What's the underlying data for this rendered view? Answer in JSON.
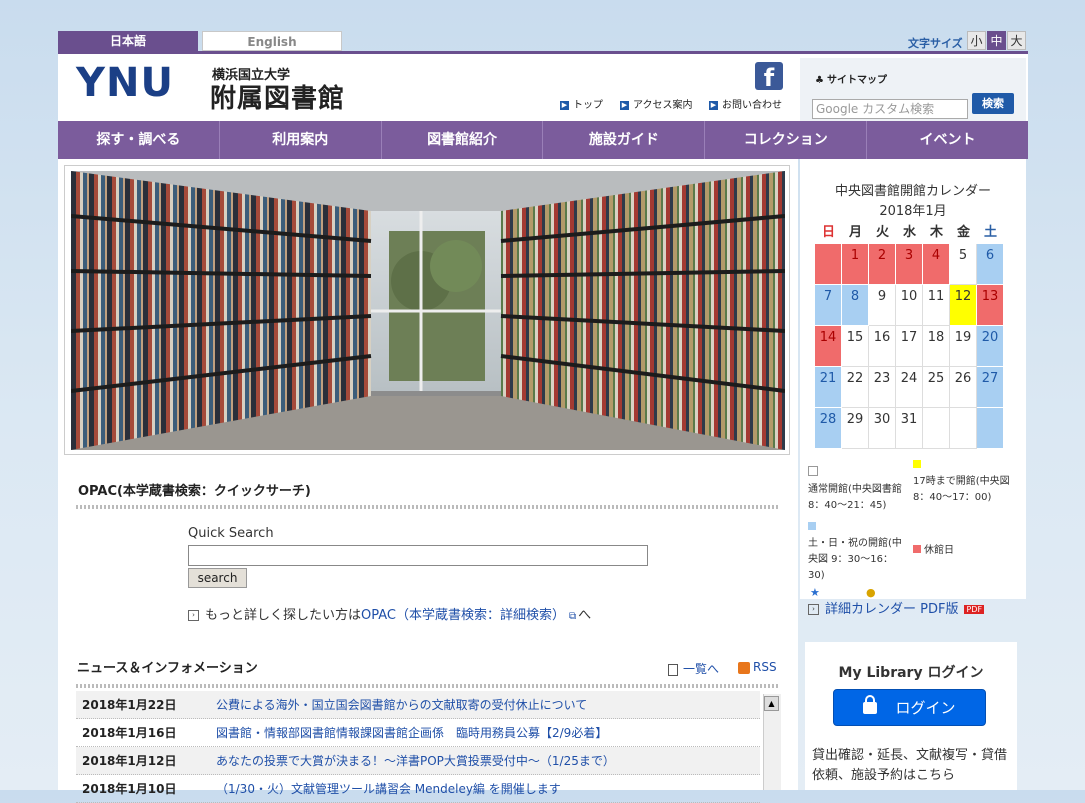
{
  "lang_tabs": {
    "japanese": "日本語",
    "english": "English"
  },
  "font_size": {
    "label": "文字サイズ",
    "small": "小",
    "medium": "中",
    "large": "大"
  },
  "header": {
    "logo_ynu": "YNU",
    "logo_univ": "横浜国立大学",
    "logo_lib": "附属図書館",
    "links": {
      "top": "トップ",
      "access": "アクセス案内",
      "contact": "お問い合わせ"
    },
    "sitemap": "サイトマップ",
    "search_placeholder": "Google カスタム検索",
    "search_button": "検索"
  },
  "nav": [
    "探す・調べる",
    "利用案内",
    "図書館紹介",
    "施設ガイド",
    "コレクション",
    "イベント"
  ],
  "opac": {
    "title": "OPAC(本学蔵書検索：クイックサーチ)",
    "quick_label": "Quick Search",
    "search_button": "search",
    "more_prefix": "もっと詳しく探したい方は",
    "more_link": "OPAC（本学蔵書検索：詳細検索）",
    "more_suffix": "へ"
  },
  "news": {
    "title": "ニュース＆インフォメーション",
    "list_link": "一覧へ",
    "rss": "RSS",
    "items": [
      {
        "date": "2018年1月22日",
        "text": "公費による海外・国立国会図書館からの文献取寄の受付休止について"
      },
      {
        "date": "2018年1月16日",
        "text": "図書館・情報部図書館情報課図書館企画係　臨時用務員公募【2/9必着】"
      },
      {
        "date": "2018年1月12日",
        "text": "あなたの投票で大賞が決まる！～洋書POP大賞投票受付中～（1/25まで）"
      },
      {
        "date": "2018年1月10日",
        "text": "（1/30・火）文献管理ツール講習会 Mendeley編 を開催します"
      }
    ]
  },
  "calendar": {
    "title": "中央図書館開館カレンダー",
    "month": "2018年1月",
    "weekdays": [
      "日",
      "月",
      "火",
      "水",
      "木",
      "金",
      "土"
    ],
    "days": [
      {
        "d": "",
        "t": "closed"
      },
      {
        "d": "1",
        "t": "closed"
      },
      {
        "d": "2",
        "t": "closed"
      },
      {
        "d": "3",
        "t": "closed"
      },
      {
        "d": "4",
        "t": "closed"
      },
      {
        "d": "5",
        "t": "normal"
      },
      {
        "d": "6",
        "t": "weekend"
      },
      {
        "d": "7",
        "t": "weekend"
      },
      {
        "d": "8",
        "t": "weekend"
      },
      {
        "d": "9",
        "t": "normal"
      },
      {
        "d": "10",
        "t": "normal"
      },
      {
        "d": "11",
        "t": "normal"
      },
      {
        "d": "12",
        "t": "short"
      },
      {
        "d": "13",
        "t": "closed"
      },
      {
        "d": "14",
        "t": "closed"
      },
      {
        "d": "15",
        "t": "normal"
      },
      {
        "d": "16",
        "t": "normal"
      },
      {
        "d": "17",
        "t": "normal"
      },
      {
        "d": "18",
        "t": "normal"
      },
      {
        "d": "19",
        "t": "normal"
      },
      {
        "d": "20",
        "t": "weekend"
      },
      {
        "d": "21",
        "t": "weekend"
      },
      {
        "d": "22",
        "t": "normal"
      },
      {
        "d": "23",
        "t": "normal"
      },
      {
        "d": "24",
        "t": "normal"
      },
      {
        "d": "25",
        "t": "normal"
      },
      {
        "d": "26",
        "t": "normal"
      },
      {
        "d": "27",
        "t": "weekend"
      },
      {
        "d": "28",
        "t": "weekend"
      },
      {
        "d": "29",
        "t": "normal"
      },
      {
        "d": "30",
        "t": "normal"
      },
      {
        "d": "31",
        "t": "normal"
      },
      {
        "d": "",
        "t": "normal"
      },
      {
        "d": "",
        "t": "normal"
      },
      {
        "d": "",
        "t": "weekend"
      }
    ],
    "legend": {
      "normal": "通常開館(中央図書館 8：40～21：45)",
      "short": "17時まで開館(中央図 8：40～17：00)",
      "weekend": "土・日・祝の開館(中央図 9：30～16：30)",
      "closed": "休館日"
    },
    "pdf_link": "詳細カレンダー PDF版",
    "pdf_badge": "PDF"
  },
  "mylibrary": {
    "title": "My Library ログイン",
    "login_button": "ログイン",
    "desc": "貸出確認・延長、文献複写・貸借依頼、施設予約はこちら"
  },
  "colors": {
    "brand_purple": "#6a4f8e",
    "nav_purple": "#7b5c9c",
    "link_blue": "#1f4fa8",
    "closed_red": "#f06b6b",
    "weekend_blue": "#a8cff2",
    "short_yellow": "#ffff00"
  }
}
